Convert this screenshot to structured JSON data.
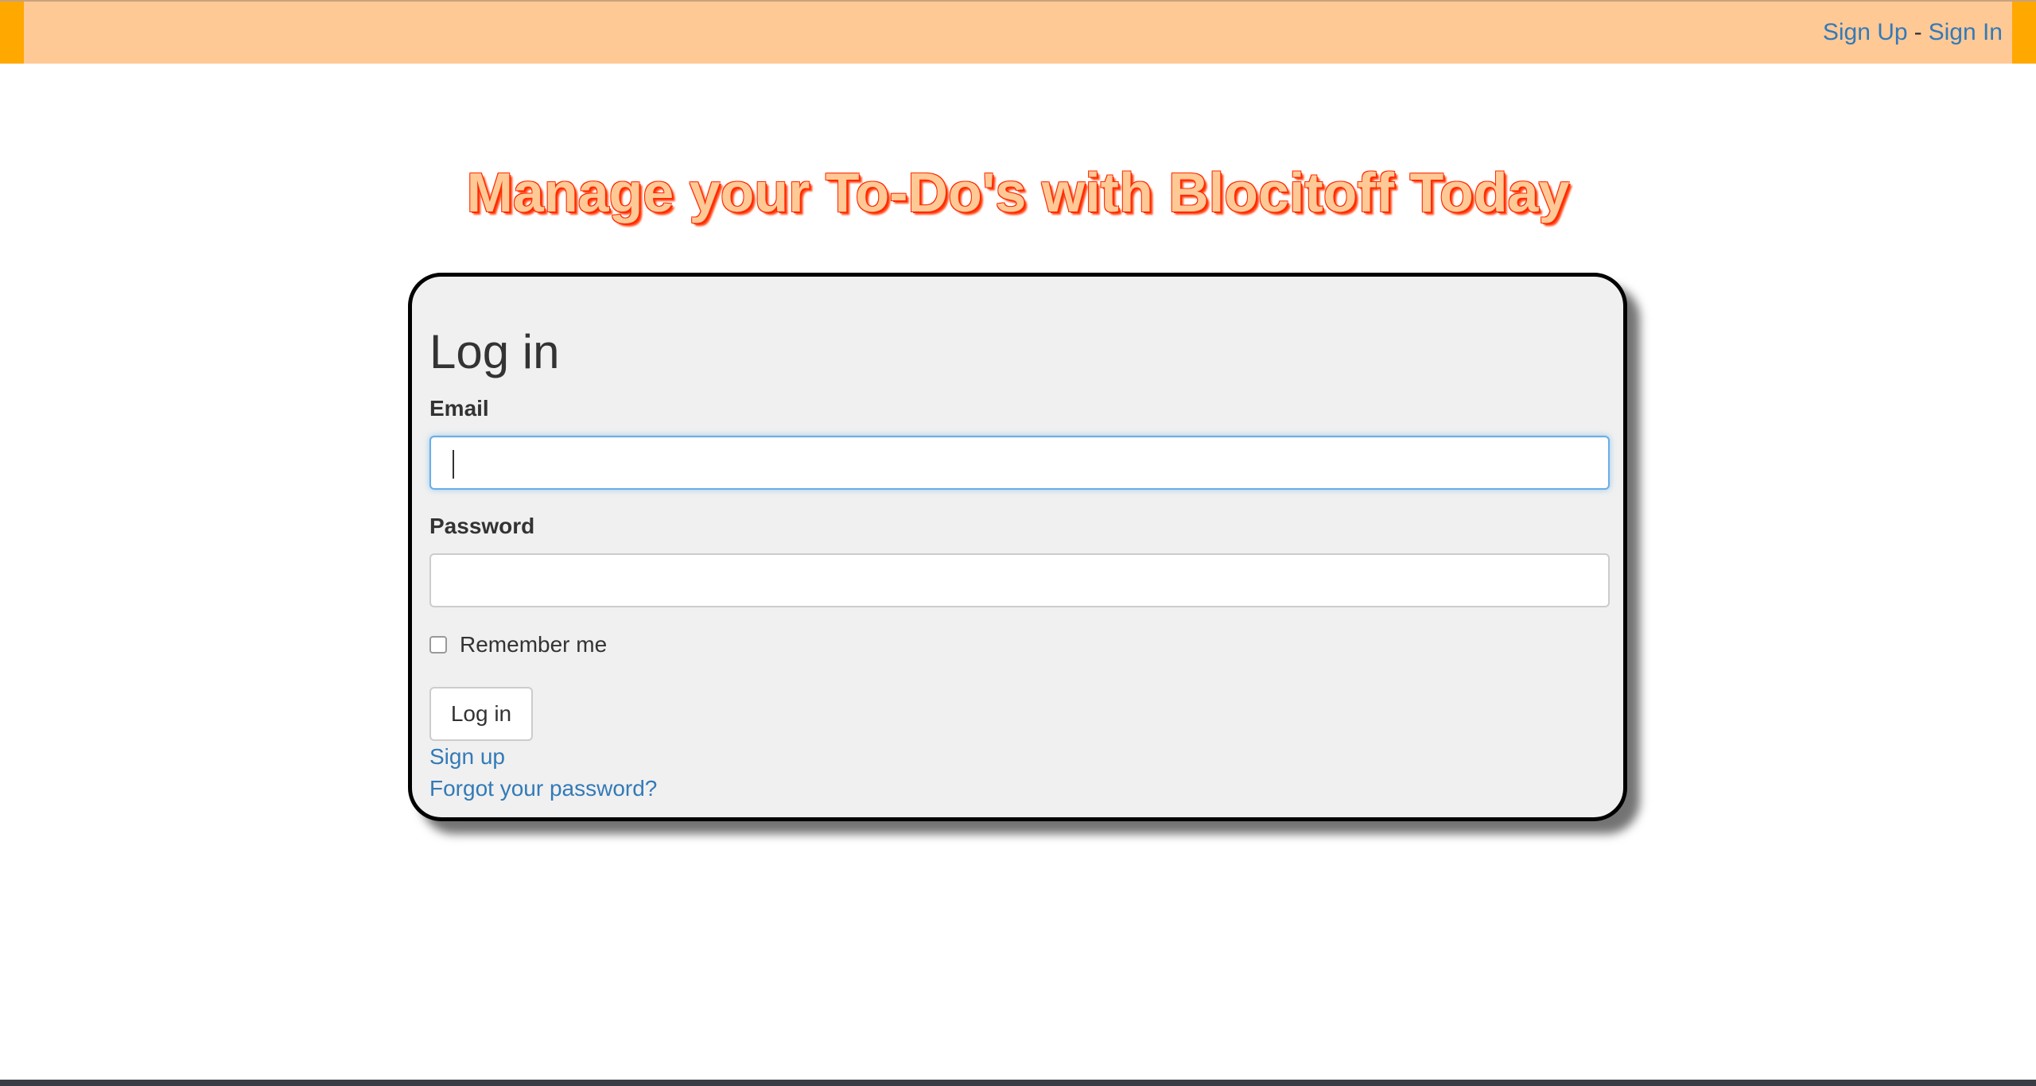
{
  "header": {
    "nav": {
      "sign_up": "Sign Up",
      "separator": "-",
      "sign_in": "Sign In"
    }
  },
  "hero": {
    "headline": "Manage your To-Do's with Blocitoff Today"
  },
  "login_form": {
    "title": "Log in",
    "email_label": "Email",
    "email_value": "",
    "password_label": "Password",
    "password_value": "",
    "remember_label": "Remember me",
    "remember_checked": false,
    "submit_label": "Log in",
    "sign_up_link": "Sign up",
    "forgot_link": "Forgot your password?"
  },
  "colors": {
    "topbar": "#ffc996",
    "topbar_accent": "#ffa800",
    "link": "#337ab7",
    "headline_stroke": "#ff2a00",
    "card_background": "#f0f0f0",
    "focus_ring": "#66afe9"
  }
}
